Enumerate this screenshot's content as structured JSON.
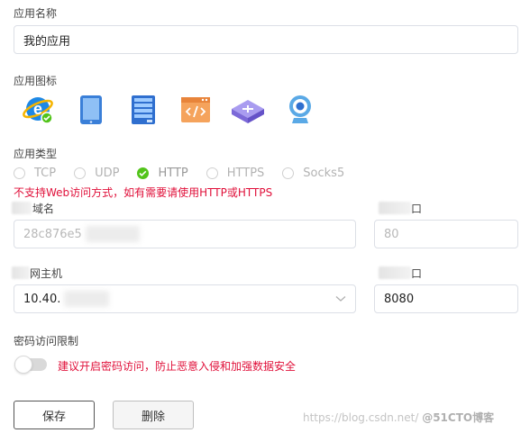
{
  "app_name": {
    "label": "应用名称",
    "value": "我的应用"
  },
  "app_icon": {
    "label": "应用图标",
    "icons": [
      "ie-browser-icon",
      "tablet-icon",
      "server-icon",
      "code-window-icon",
      "network-router-icon",
      "webcam-icon"
    ]
  },
  "app_type": {
    "label": "应用类型",
    "options": [
      {
        "label": "TCP",
        "checked": false
      },
      {
        "label": "UDP",
        "checked": false
      },
      {
        "label": "HTTP",
        "checked": true
      },
      {
        "label": "HTTPS",
        "checked": false
      },
      {
        "label": "Socks5",
        "checked": false
      }
    ],
    "warning": "不支持Web访问方式，如有需要请使用HTTP或HTTPS"
  },
  "domain": {
    "label": "域名",
    "value": "28c876e5"
  },
  "domain_port": {
    "label": "口",
    "value": "80"
  },
  "host": {
    "label": "网主机",
    "value": "10.40."
  },
  "host_port": {
    "label": "口",
    "value": "8080"
  },
  "password": {
    "label": "密码访问限制",
    "hint": "建议开启密码访问，防止恶意入侵和加强数据安全"
  },
  "buttons": {
    "save": "保存",
    "delete": "删除"
  },
  "watermark": {
    "url": "https://blog.csdn.net/",
    "brand": "@51CTO博客"
  },
  "colors": {
    "accent_green": "#52c41a",
    "warning_red": "#e0103a"
  }
}
